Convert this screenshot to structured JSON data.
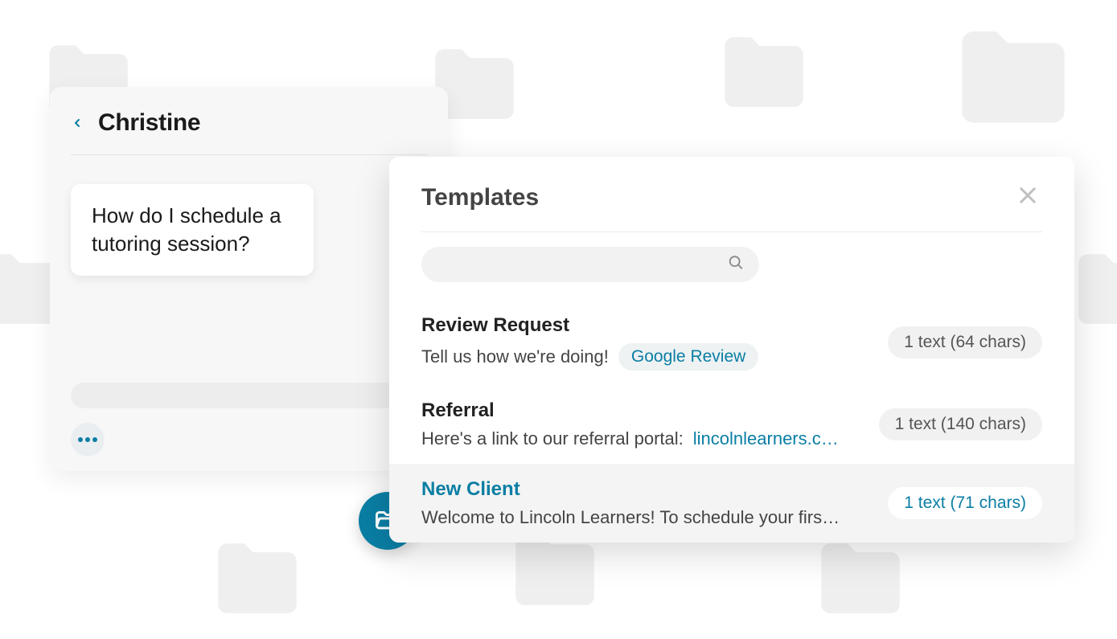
{
  "chat": {
    "name": "Christine",
    "message": "How do I schedule a tutoring session?"
  },
  "templates": {
    "title": "Templates",
    "search_placeholder": "",
    "items": [
      {
        "name": "Review Request",
        "preview_text": "Tell us how we're doing!",
        "tag": "Google Review",
        "count": "1 text (64 chars)",
        "selected": false
      },
      {
        "name": "Referral",
        "preview_text": "Here's a link to our referral portal: ",
        "link": "lincolnlearners.c…",
        "count": "1 text (140 chars)",
        "selected": false
      },
      {
        "name": "New Client",
        "preview_text": "Welcome to Lincoln Learners! To schedule your firs…",
        "count": "1 text (71 chars)",
        "selected": true
      }
    ]
  }
}
